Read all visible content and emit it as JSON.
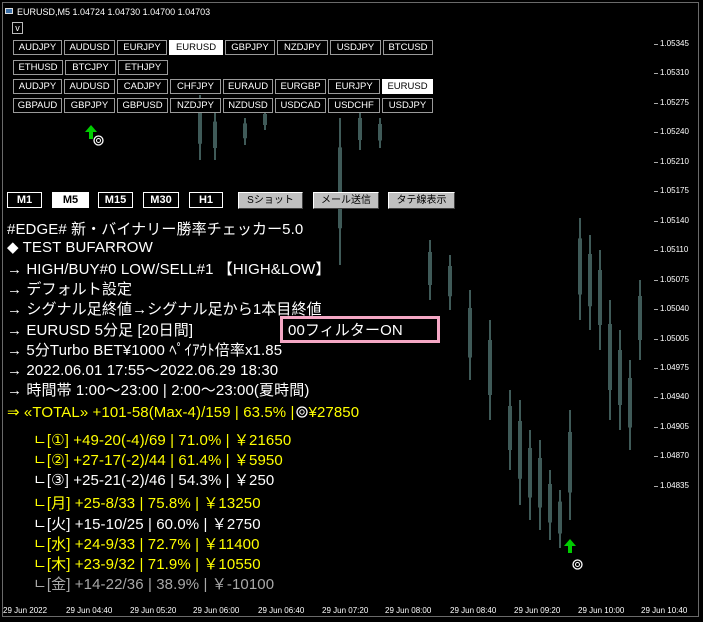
{
  "window": {
    "title": "EURUSD,M5  1.04724 1.04730 1.04700 1.04703",
    "collapse_label": "v"
  },
  "symbols": {
    "row1": [
      "AUDJPY",
      "AUDUSD",
      "EURJPY",
      "EURUSD",
      "GBPJPY",
      "NZDJPY",
      "USDJPY",
      "BTCUSD"
    ],
    "row2": [
      "ETHUSD",
      "BTCJPY",
      "ETHJPY"
    ],
    "row3": [
      "AUDJPY",
      "AUDUSD",
      "CADJPY",
      "CHFJPY",
      "EURAUD",
      "EURGBP",
      "EURJPY",
      "EURUSD"
    ],
    "row4": [
      "GBPAUD",
      "GBPJPY",
      "GBPUSD",
      "NZDJPY",
      "NZDUSD",
      "USDCAD",
      "USDCHF",
      "USDJPY"
    ],
    "active": "EURUSD"
  },
  "timeframes": [
    "M1",
    "M5",
    "M15",
    "M30",
    "H1"
  ],
  "active_timeframe": "M5",
  "tools": [
    "Sショット",
    "メール送信",
    "タテ線表示"
  ],
  "stats": {
    "l1": "#EDGE# 新・バイナリー勝率チェッカー5.0",
    "l2": "◆ TEST BUFARROW",
    "l3": "→ HIGH/BUY#0  LOW/SELL#1   【HIGH&LOW】",
    "l4": "→ デフォルト設定",
    "l5": "→ シグナル足終値→シグナル足から1本目終値",
    "l6a": "→ EURUSD    5分足   [20日間]",
    "l6b": "00フィルターON",
    "l7": "→ 5分Turbo  BET¥1000  ﾍﾟｲｱｳﾄ倍率x1.85",
    "l8": "→ 2022.06.01 17:55～2022.06.29 18:30",
    "l9": "→ 時間帯 1:00～23:00 | 2:00～23:00(夏時間)",
    "total": "⇒ «TOTAL» +101-58(Max-4)/159 | 63.5% |",
    "total_amt": "¥27850",
    "r1": "ㄴ[①] +49-20(-4)/69 | 71.0% | ￥21650",
    "r2": "ㄴ[②] +27-17(-2)/44 | 61.4% | ￥5950",
    "r3": "ㄴ[③] +25-21(-2)/46 | 54.3% | ￥250",
    "d1": "ㄴ[月] +25-8/33 | 75.8% | ￥13250",
    "d2": "ㄴ[火] +15-10/25 | 60.0% | ￥2750",
    "d3": "ㄴ[水] +24-9/33 | 72.7% | ￥11400",
    "d4": "ㄴ[木] +23-9/32 | 71.9% | ￥10550",
    "d5": "ㄴ[金] +14-22/36 | 38.9% | ￥-10100"
  },
  "colors": {
    "yellow": "#ffff00",
    "white": "#ffffff",
    "gray": "#a8a8a8",
    "candle": "#3f5a58",
    "arrow": "#00cc00",
    "highlight": "#f4a7c4"
  },
  "y_axis": [
    "1.05345",
    "1.05310",
    "1.05275",
    "1.05240",
    "1.05210",
    "1.05175",
    "1.05140",
    "1.05110",
    "1.05075",
    "1.05040",
    "1.05005",
    "1.04975",
    "1.04940",
    "1.04905",
    "1.04870",
    "1.04835"
  ],
  "x_axis": [
    "29 Jun 2022",
    "29 Jun 04:40",
    "29 Jun 05:20",
    "29 Jun 06:00",
    "29 Jun 06:40",
    "29 Jun 07:20",
    "29 Jun 08:00",
    "29 Jun 08:40",
    "29 Jun 09:20",
    "29 Jun 10:00",
    "29 Jun 10:40"
  ]
}
